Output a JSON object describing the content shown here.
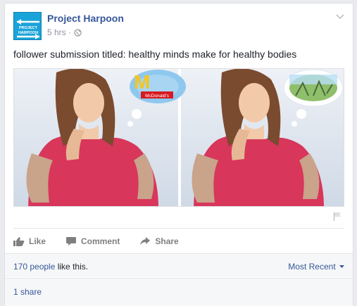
{
  "post": {
    "page_name": "Project Harpoon",
    "timestamp": "5 hrs",
    "separator": "·",
    "privacy_icon": "globe-icon",
    "avatar_text": [
      "PROJECT",
      "HARPOON"
    ],
    "text": "follower submission titled: healthy minds make for healthy bodies",
    "photo": {
      "left_bubble_text": "McDonald's",
      "colors": {
        "background": "#dfe6f0",
        "dress": "#d8365a",
        "hair": "#7a4b2e",
        "skin": "#f2c9a9",
        "bubble": "#8ec8ee"
      }
    }
  },
  "actions": [
    {
      "label": "Like",
      "icon": "thumbs-up-icon"
    },
    {
      "label": "Comment",
      "icon": "comment-icon"
    },
    {
      "label": "Share",
      "icon": "share-arrow-icon"
    }
  ],
  "summary": {
    "likes_count": "170 people",
    "likes_suffix": " like this.",
    "sort_label": "Most Recent",
    "shares": "1 share"
  },
  "colors": {
    "link": "#365899",
    "muted": "#90949c"
  }
}
